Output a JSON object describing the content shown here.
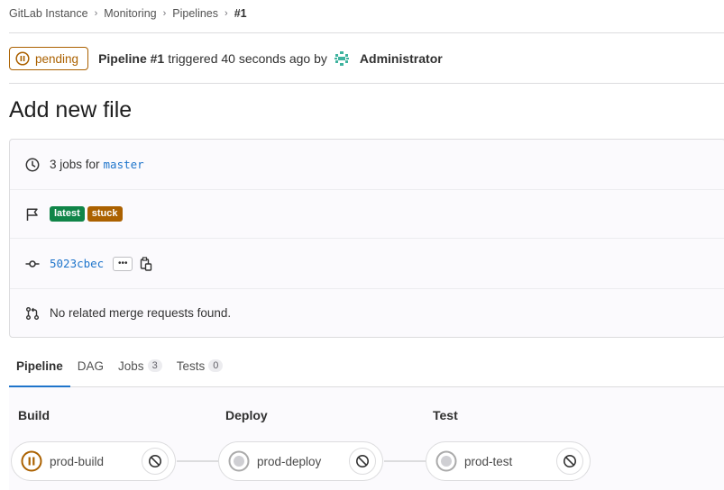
{
  "breadcrumb": [
    "GitLab Instance",
    "Monitoring",
    "Pipelines",
    "#1"
  ],
  "header": {
    "status": "pending",
    "pipeline_label": "Pipeline #1",
    "triggered_text": "triggered 40 seconds ago by",
    "user": "Administrator"
  },
  "title": "Add new file",
  "info": {
    "jobs_prefix": "3 jobs for",
    "branch": "master",
    "badges": [
      "latest",
      "stuck"
    ],
    "commit_sha": "5023cbec",
    "ellipsis": "•••",
    "merge_requests": "No related merge requests found."
  },
  "tabs": [
    {
      "label": "Pipeline",
      "count": ""
    },
    {
      "label": "DAG",
      "count": ""
    },
    {
      "label": "Jobs",
      "count": "3"
    },
    {
      "label": "Tests",
      "count": "0"
    }
  ],
  "stages": [
    {
      "title": "Build",
      "job": "prod-build",
      "status": "pending"
    },
    {
      "title": "Deploy",
      "job": "prod-deploy",
      "status": "created"
    },
    {
      "title": "Test",
      "job": "prod-test",
      "status": "created"
    }
  ],
  "colors": {
    "pending": "#ab6100",
    "link": "#1f75cb",
    "latest": "#108548",
    "stuck": "#ab6100"
  }
}
